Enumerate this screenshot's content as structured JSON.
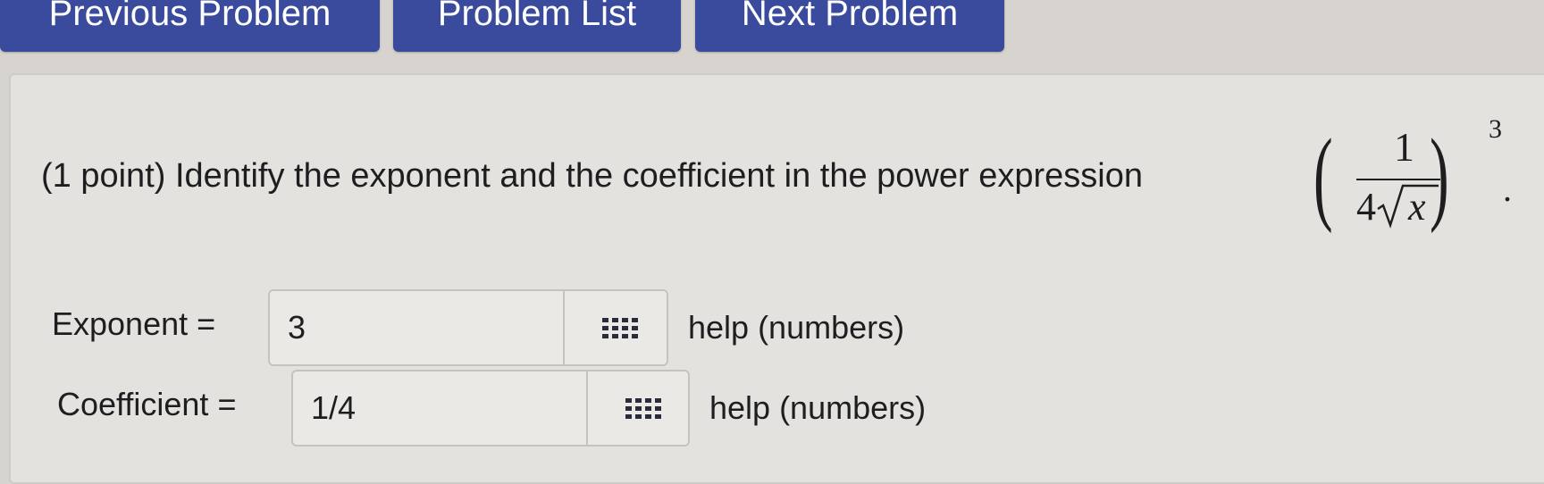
{
  "nav": {
    "previous_label": "Previous Problem",
    "list_label": "Problem List",
    "next_label": "Next Problem"
  },
  "problem": {
    "text": "(1 point) Identify the exponent and the coefficient in the power expression",
    "expression": {
      "numerator": "1",
      "denominator_coefficient": "4",
      "denominator_variable": "x",
      "power": "3",
      "trailing": "."
    }
  },
  "answers": {
    "exponent": {
      "label": "Exponent =",
      "value": "3",
      "help": "help (numbers)"
    },
    "coefficient": {
      "label": "Coefficient =",
      "value": "1/4",
      "help": "help (numbers)"
    }
  },
  "colors": {
    "nav_button": "#3a4a9c",
    "panel": "#e4e2de",
    "input_bg": "#ebe9e6"
  }
}
